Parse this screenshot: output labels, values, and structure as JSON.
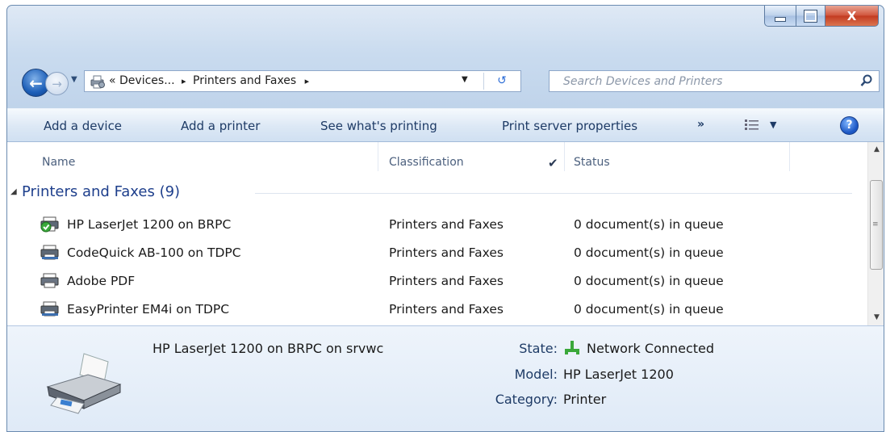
{
  "window": {
    "close_label": "X"
  },
  "nav": {
    "breadcrumb_root": "«",
    "breadcrumb_1": "Devices...",
    "breadcrumb_sep": "▸",
    "breadcrumb_2": "Printers and Faxes",
    "breadcrumb_end": "▸",
    "search_placeholder": "Search Devices and Printers"
  },
  "toolbar": {
    "add_device": "Add a device",
    "add_printer": "Add a printer",
    "see_printing": "See what's printing",
    "print_server": "Print server properties",
    "more": "»"
  },
  "columns": {
    "name": "Name",
    "classification": "Classification",
    "status": "Status"
  },
  "group": {
    "label": "Printers and Faxes (9)"
  },
  "printers": [
    {
      "name": "HP LaserJet 1200 on BRPC",
      "classification": "Printers and Faxes",
      "status": "0 document(s) in queue",
      "icon": "network-printer-default-icon"
    },
    {
      "name": "CodeQuick AB-100 on TDPC",
      "classification": "Printers and Faxes",
      "status": "0 document(s) in queue",
      "icon": "network-printer-icon"
    },
    {
      "name": "Adobe PDF",
      "classification": "Printers and Faxes",
      "status": "0 document(s) in queue",
      "icon": "printer-icon"
    },
    {
      "name": "EasyPrinter EM4i on TDPC",
      "classification": "Printers and Faxes",
      "status": "0 document(s) in queue",
      "icon": "network-printer-icon"
    }
  ],
  "details": {
    "title": "HP LaserJet 1200 on BRPC on srvwc",
    "state_label": "State:",
    "state_value": "Network Connected",
    "model_label": "Model:",
    "model_value": "HP LaserJet 1200",
    "category_label": "Category:",
    "category_value": "Printer"
  },
  "colors": {
    "accent": "#1e3f8c",
    "close": "#c94a30",
    "toolbar_text": "#1e3b66"
  }
}
